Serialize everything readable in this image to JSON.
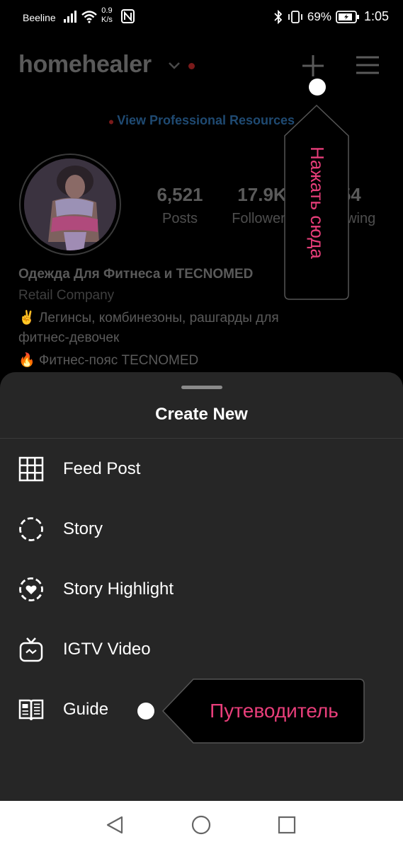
{
  "status_bar": {
    "carrier": "Beeline",
    "speed_value": "0.9",
    "speed_unit": "K/s",
    "battery": "69%",
    "time": "1:05"
  },
  "profile": {
    "username": "homehealer",
    "resources_link": "View Professional Resources",
    "stats": [
      {
        "value": "6,521",
        "label": "Posts"
      },
      {
        "value": "17.9K",
        "label": "Followers"
      },
      {
        "value": "554",
        "label": "Following"
      }
    ],
    "name": "Одежда Для Фитнеса и TECNOMED",
    "category": "Retail Company",
    "bio_lines": [
      "✌️ Легинсы, комбинезоны, рашгарды для",
      "фитнес-девочек",
      "🔥 Фитнес-пояс TECNOMED"
    ]
  },
  "sheet": {
    "title": "Create New",
    "items": [
      {
        "label": "Feed Post",
        "icon": "grid-icon"
      },
      {
        "label": "Story",
        "icon": "story-circle-icon"
      },
      {
        "label": "Story Highlight",
        "icon": "highlight-heart-icon"
      },
      {
        "label": "IGTV Video",
        "icon": "igtv-icon"
      },
      {
        "label": "Guide",
        "icon": "guide-book-icon"
      }
    ]
  },
  "callouts": {
    "plus_hint": "Нажать сюда",
    "guide_hint": "Путеводитель"
  },
  "colors": {
    "accent_pink": "#e83e7a",
    "sheet_bg": "#262626",
    "link_blue": "#1f4a72"
  }
}
